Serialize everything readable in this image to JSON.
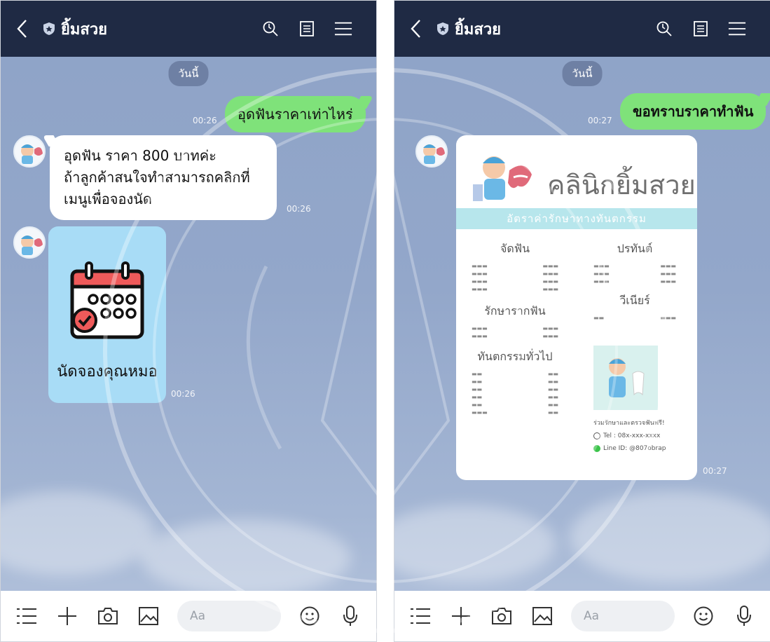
{
  "left": {
    "title": "ยิ้มสวย",
    "date_chip": "วันนี้",
    "user_message": "อุดฟันราคาเท่าไหร่",
    "user_time": "00:26",
    "bot_line1": "อุดฟัน ราคา 800 บาทค่ะ",
    "bot_line2": "ถ้าลูกค้าสนใจทำสามารถคลิกที่",
    "bot_line3": "เมนูเพื่อจองนัด",
    "bot_time": "00:26",
    "card_label": "นัดจองคุณหมอ",
    "card_time": "00:26",
    "input_placeholder": "Aa"
  },
  "right": {
    "title": "ยิ้มสวย",
    "date_chip": "วันนี้",
    "user_message": "ขอทราบราคาทำฟัน",
    "user_time": "00:27",
    "card_title": "คลินิกยิ้มสวย",
    "card_banner": "อัตราค่ารักษาทางทันตกรรม",
    "sec_orthodontic": "จัดฟัน",
    "sec_implant": "ปรทันต์",
    "sec_root": "รักษารากฟัน",
    "sec_veneer": "วีเนียร์",
    "sec_general": "ทันตกรรมทั่วไป",
    "contact_heading": "ร่วมรักษาและตรวจฟันฟรี!",
    "contact_tel": "Tel : 08x-xxx-xxxx",
    "contact_line": "Line ID: @807obrap",
    "card_time": "00:27",
    "input_placeholder": "Aa"
  },
  "colors": {
    "topbar": "#1f2a44",
    "user_bubble": "#7fe27a",
    "bot_bubble": "#ffffff",
    "card_blue": "#a8dcf6",
    "chat_bg": "#93a7ca"
  },
  "icons": [
    "back-icon",
    "shield-icon",
    "search-icon",
    "notes-icon",
    "menu-icon",
    "list-icon",
    "plus-icon",
    "camera-icon",
    "image-icon",
    "emoji-icon",
    "mic-icon",
    "calendar-icon"
  ]
}
